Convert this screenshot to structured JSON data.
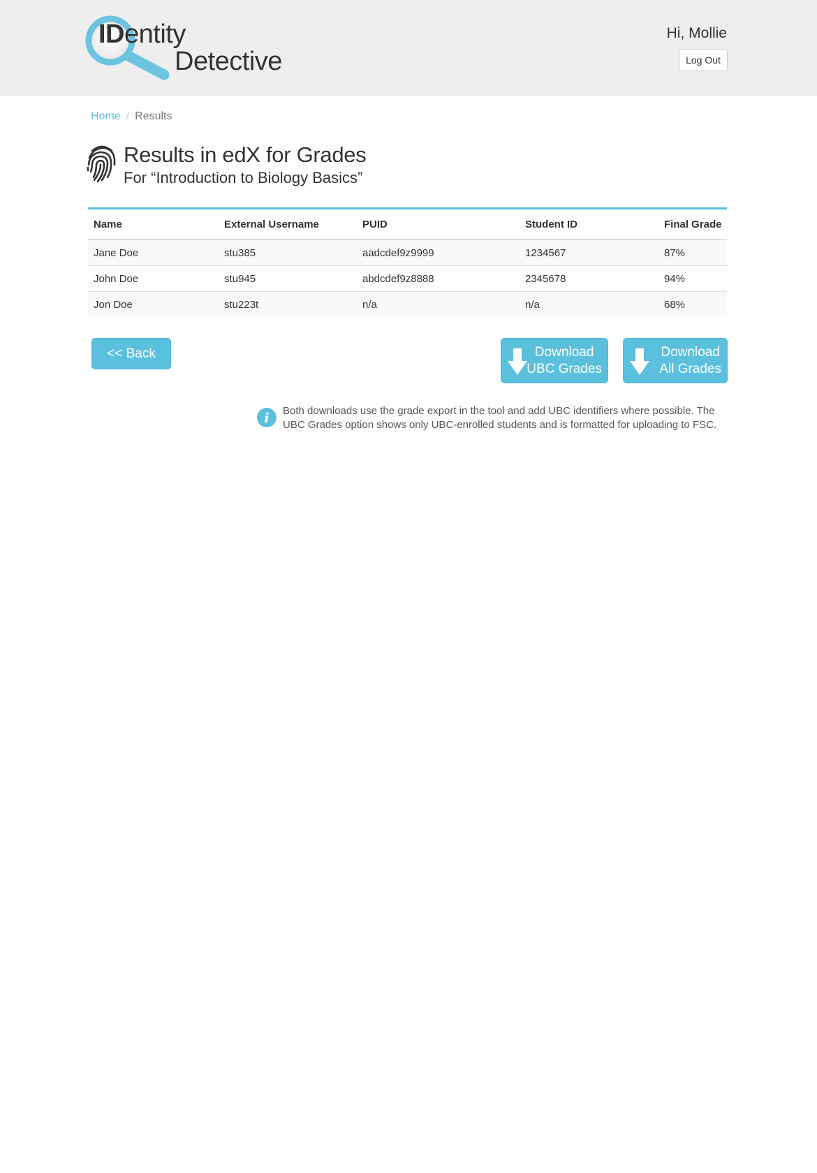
{
  "header": {
    "logo_id": "ID",
    "logo_entity": "entity",
    "logo_detective": "Detective",
    "greeting": "Hi, Mollie",
    "logout_label": "Log Out"
  },
  "breadcrumb": {
    "home": "Home",
    "separator": "/",
    "current": "Results"
  },
  "page": {
    "title": "Results in edX for Grades",
    "subtitle": "For “Introduction to Biology Basics”"
  },
  "table": {
    "headers": [
      "Name",
      "External Username",
      "PUID",
      "Student ID",
      "Final Grade"
    ],
    "rows": [
      [
        "Jane Doe",
        "stu385",
        "aadcdef9z9999",
        "1234567",
        "87%"
      ],
      [
        "John Doe",
        "stu945",
        "abdcdef9z8888",
        "2345678",
        "94%"
      ],
      [
        "Jon Doe",
        "stu223t",
        "n/a",
        "n/a",
        "68%"
      ]
    ]
  },
  "actions": {
    "back_label": "<< Back",
    "download_ubc_line1": "Download",
    "download_ubc_line2": "UBC Grades",
    "download_all_line1": "Download",
    "download_all_line2": "All Grades"
  },
  "info": {
    "text": "Both downloads use the grade export in the tool and add UBC identifiers where possible. The UBC Grades option shows only UBC-enrolled students and is formatted for uploading to FSC."
  },
  "colors": {
    "accent": "#5bc0de",
    "header_bg": "#eeeeee",
    "text": "#333333"
  },
  "icons": {
    "logo": "magnifying-glass-icon",
    "heading": "fingerprint-icon",
    "download": "download-arrow-icon",
    "info": "info-icon"
  }
}
